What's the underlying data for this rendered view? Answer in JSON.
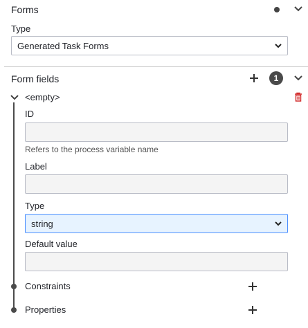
{
  "forms": {
    "title": "Forms"
  },
  "type_field": {
    "label": "Type",
    "value": "Generated Task Forms"
  },
  "form_fields": {
    "title": "Form fields",
    "count": "1"
  },
  "entry": {
    "name": "<empty>",
    "id_label": "ID",
    "id_value": "",
    "id_hint": "Refers to the process variable name",
    "label_label": "Label",
    "label_value": "",
    "type_label": "Type",
    "type_value": "string",
    "default_label": "Default value",
    "default_value": ""
  },
  "constraints": {
    "label": "Constraints"
  },
  "properties": {
    "label": "Properties"
  },
  "colors": {
    "delete": "#d32f2f",
    "focus_border": "#4d90ff",
    "focus_bg": "#e7f3ff"
  }
}
